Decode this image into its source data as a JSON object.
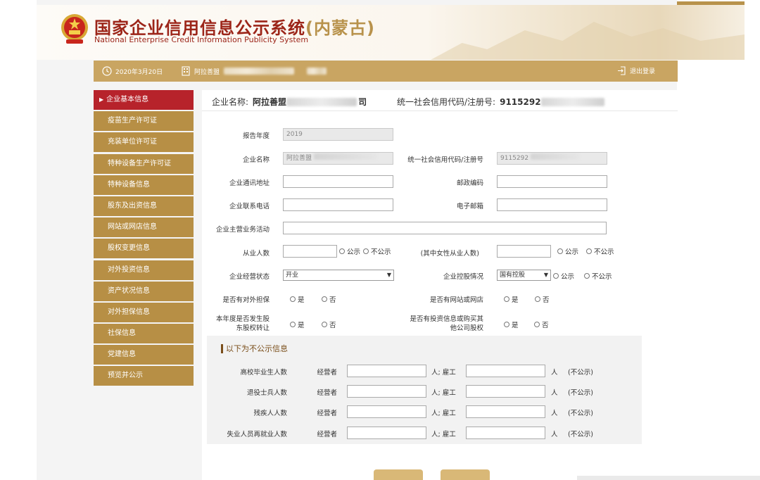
{
  "header": {
    "title_cn": "国家企业信用信息公示系统",
    "title_region": "(内蒙古)",
    "title_en": "National Enterprise Credit Information Publicity System"
  },
  "infobar": {
    "date": "2020年3月20日",
    "user_prefix": "阿拉善盟",
    "logout": "退出登录"
  },
  "sidebar": {
    "items": [
      {
        "label": "企业基本信息",
        "active": true
      },
      {
        "label": "疫苗生产许可证"
      },
      {
        "label": "充装单位许可证"
      },
      {
        "label": "特种设备生产许可证"
      },
      {
        "label": "特种设备信息"
      },
      {
        "label": "股东及出资信息"
      },
      {
        "label": "网站或网店信息"
      },
      {
        "label": "股权变更信息"
      },
      {
        "label": "对外投资信息"
      },
      {
        "label": "资产状况信息"
      },
      {
        "label": "对外担保信息"
      },
      {
        "label": "社保信息"
      },
      {
        "label": "党建信息"
      },
      {
        "label": "预览并公示"
      }
    ]
  },
  "main_head": {
    "name_label": "企业名称:",
    "name_value": "阿拉善盟",
    "name_tail": "司",
    "code_label": "统一社会信用代码/注册号:",
    "code_value": "9115292"
  },
  "form": {
    "report_year_label": "报告年度",
    "report_year_value": "2019",
    "company_name_label": "企业名称",
    "company_name_value": "阿拉善盟",
    "credit_code_label": "统一社会信用代码/注册号",
    "credit_code_value": "9115292",
    "address_label": "企业通讯地址",
    "postcode_label": "邮政编码",
    "phone_label": "企业联系电话",
    "email_label": "电子邮箱",
    "business_label": "企业主营业务活动",
    "employees_label": "从业人数",
    "public": "公示",
    "not_public": "不公示",
    "female_label": "(其中女性从业人数)",
    "status_label": "企业经营状态",
    "status_value": "开业",
    "holding_label": "企业控股情况",
    "holding_value": "国有控股",
    "guarantee_label": "是否有对外担保",
    "yes": "是",
    "no": "否",
    "website_label": "是否有网站或网店",
    "equity_transfer_label_1": "本年度是否发生股",
    "equity_transfer_label_2": "东股权转让",
    "invest_label_1": "是否有投资信息或购买其",
    "invest_label_2": "他公司股权"
  },
  "nonpublic": {
    "title": "以下为不公示信息",
    "operator": "经营者",
    "person_sep": "人; 雇工",
    "person": "人",
    "not_public_note": "(不公示)",
    "rows": [
      {
        "label": "高校毕业生人数"
      },
      {
        "label": "退役士兵人数"
      },
      {
        "label": "残疾人人数"
      },
      {
        "label": "失业人员再就业人数"
      }
    ]
  },
  "colors": {
    "gold": "#c9a562",
    "side_gold": "#b78f45",
    "active_red": "#b7232b",
    "title_red": "#9c2519"
  }
}
